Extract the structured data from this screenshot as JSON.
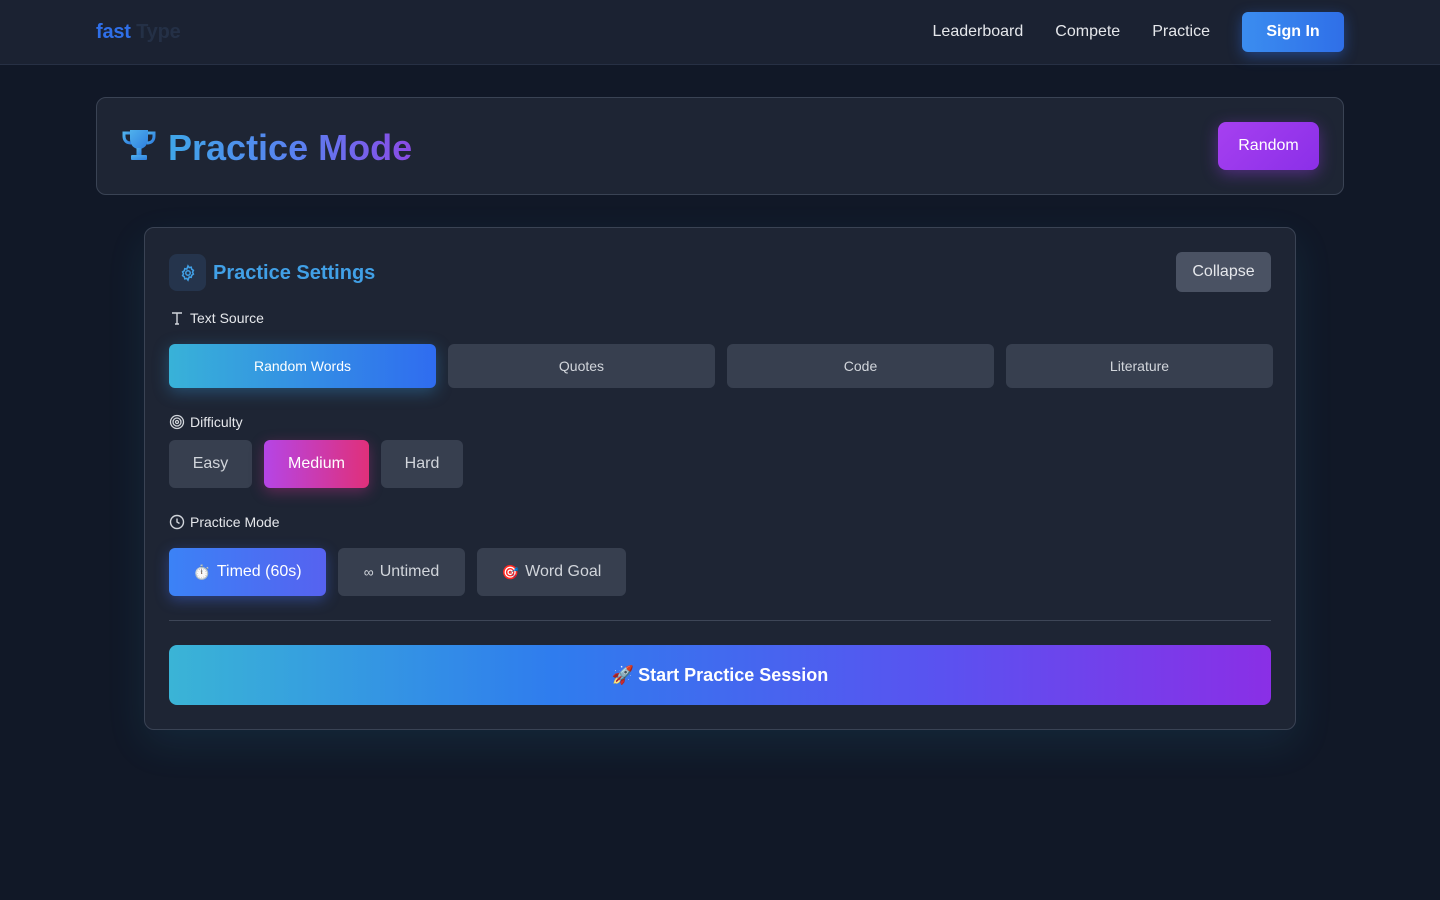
{
  "nav": {
    "logo_part1": "fast",
    "logo_part2": "Type",
    "links": [
      "Leaderboard",
      "Compete",
      "Practice"
    ],
    "signin_label": "Sign In"
  },
  "header": {
    "title": "Practice Mode",
    "random_label": "Random"
  },
  "settings": {
    "title": "Practice Settings",
    "collapse_label": "Collapse",
    "text_source": {
      "label": "Text Source",
      "options": [
        "Random Words",
        "Quotes",
        "Code",
        "Literature"
      ],
      "selected": "Random Words"
    },
    "difficulty": {
      "label": "Difficulty",
      "options": [
        "Easy",
        "Medium",
        "Hard"
      ],
      "selected": "Medium"
    },
    "practice_mode": {
      "label": "Practice Mode",
      "options": [
        {
          "icon": "⏱️",
          "label": "Timed (60s)"
        },
        {
          "icon": "∞",
          "label": "Untimed"
        },
        {
          "icon": "🎯",
          "label": "Word Goal"
        }
      ],
      "selected": "Timed (60s)"
    },
    "start_icon": "🚀",
    "start_label": "Start Practice Session"
  },
  "colors": {
    "background": "#111827",
    "card": "#1e2534",
    "accent_blue": "#2f6fe8",
    "accent_purple": "#8b2fe8",
    "accent_pink": "#e0307a",
    "accent_cyan": "#38b2d8"
  }
}
